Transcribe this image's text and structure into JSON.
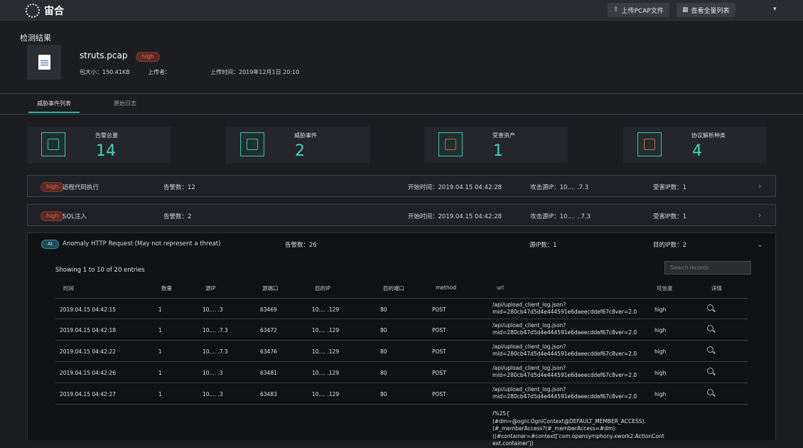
{
  "header": {
    "logo_text": "宙合",
    "upload_label": "上传PCAP文件",
    "view_all_label": "查看全量列表",
    "dropdown_caret": "▾"
  },
  "summary": {
    "title": "检测结果",
    "file_name": "struts.pcap",
    "severity": "high",
    "size_label": "包大小：150.41KB",
    "uploader_label": "上传者：",
    "upload_time_label": "上传时间：2019年12月1日 20:10"
  },
  "tabs": [
    {
      "label": "威胁事件列表",
      "active": true
    },
    {
      "label": "原始日志",
      "active": false
    }
  ],
  "stats": [
    {
      "label": "告警总量",
      "value": "14",
      "icon": "alarm-icon"
    },
    {
      "label": "威胁事件",
      "value": "2",
      "icon": "event-icon"
    },
    {
      "label": "受害资产",
      "value": "1",
      "icon": "asset-icon"
    },
    {
      "label": "协议解析种类",
      "value": "4",
      "icon": "protocol-icon"
    }
  ],
  "events": [
    {
      "severity": "high",
      "name": "远程代码执行",
      "alerts": "告警数：12",
      "start": "开始时间：2019.04.15 04:42:28",
      "attacker": "攻击源IP：10.... .7.3",
      "victims": "受害IP数：1"
    },
    {
      "severity": "high",
      "name": "SQL注入",
      "alerts": "告警数：2",
      "start": "开始时间：2019.04.15 04:42:28",
      "attacker": "攻击源IP：10.... ..7.3",
      "victims": "受害IP数：1"
    }
  ],
  "anomaly": {
    "badge": "AI",
    "name": "Anomaly HTTP Request (May not represent a threat)",
    "alerts": "告警数：26",
    "src_count": "源IP数：1",
    "dst_count": "目的IP数：2",
    "showing": "Showing 1 to 10 of 20 entries",
    "search_placeholder": "Search records",
    "columns": [
      "时间",
      "数量",
      "源IP",
      "源端口",
      "目的IP",
      "目的端口",
      "method",
      "url",
      "可信度",
      "详情"
    ],
    "rows": [
      {
        "time": "2019.04.15 04:42:15",
        "count": "1",
        "src_ip": "10.... .3",
        "src_port": "63469",
        "dst_ip": "10.... .129",
        "dst_port": "80",
        "method": "POST",
        "url1": "/api/upload_client_log.json?",
        "url2": "mid=280cb47d5d4e444591e6daeecddef67c8ver=2.0",
        "trust": "high"
      },
      {
        "time": "2019.04.15 04:42:18",
        "count": "1",
        "src_ip": "10.... .7.3",
        "src_port": "63472",
        "dst_ip": "10.... .129",
        "dst_port": "80",
        "method": "POST",
        "url1": "/api/upload_client_log.json?",
        "url2": "mid=280cb47d5d4e444591e6daeecddef67c8ver=2.0",
        "trust": "high"
      },
      {
        "time": "2019.04.15 04:42:22",
        "count": "1",
        "src_ip": "10.... .7.3",
        "src_port": "63476",
        "dst_ip": "10.... .129",
        "dst_port": "80",
        "method": "POST",
        "url1": "/api/upload_client_log.json?",
        "url2": "mid=280cb47d5d4e444591e6daeecddef67c8ver=2.0",
        "trust": "high"
      },
      {
        "time": "2019.04.15 04:42:26",
        "count": "1",
        "src_ip": "10.... .3",
        "src_port": "63481",
        "dst_ip": "10.... .129",
        "dst_port": "80",
        "method": "POST",
        "url1": "/api/upload_client_log.json?",
        "url2": "mid=280cb47d5d4e444591e6daeecddef67c8ver=2.0",
        "trust": "high"
      },
      {
        "time": "2019.04.15 04:42:27",
        "count": "1",
        "src_ip": "10.... .3",
        "src_port": "63483",
        "dst_ip": "10.... .129",
        "dst_port": "80",
        "method": "POST",
        "url1": "/api/upload_client_log.json?",
        "url2": "mid=280cb47d5d4e444591e6daeecddef67c8ver=2.0",
        "trust": "high"
      }
    ],
    "last_url": [
      "/%25{",
      "(#dm=@ognl.OgnlContext@DEFAULT_MEMBER_ACCESS).",
      "(#_memberAccess?(#_memberAccess=#dm):",
      "((#container=#context['com.opensymphony.xwork2.ActionCont",
      "ext.container'])"
    ]
  }
}
